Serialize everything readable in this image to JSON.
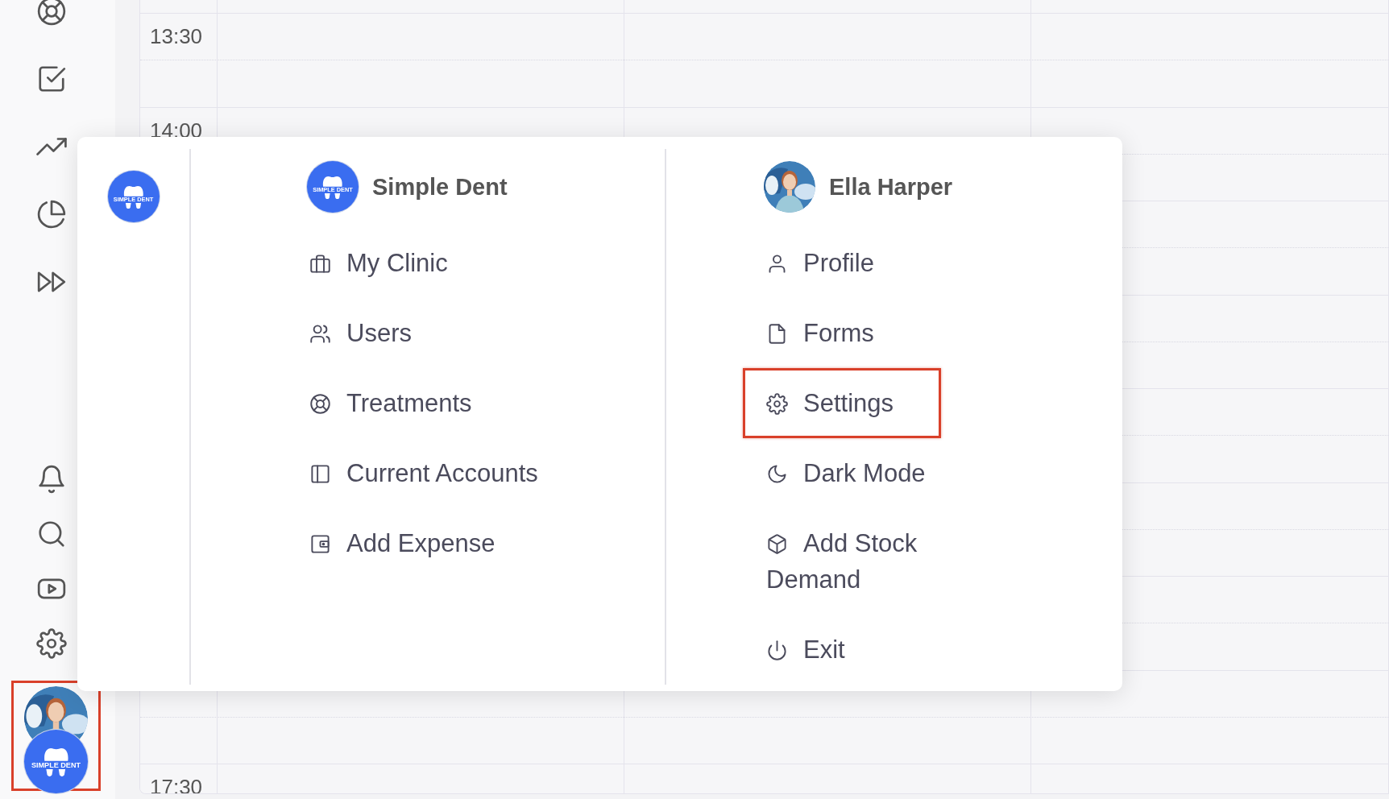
{
  "sidebar": {
    "account_switcher": {
      "highlighted": true,
      "logo_text": "SIMPLE DENT"
    }
  },
  "calendar": {
    "upper_times": [
      "13:30",
      "14:00"
    ],
    "lower_times": [
      "17:30"
    ]
  },
  "menu": {
    "logo_text": "SIMPLE DENT",
    "clinic": {
      "logo_text": "SIMPLE DENT",
      "name": "Simple Dent",
      "items": [
        {
          "label": "My Clinic",
          "highlighted": false
        },
        {
          "label": "Users",
          "highlighted": false
        },
        {
          "label": "Treatments",
          "highlighted": false
        },
        {
          "label": "Current Accounts",
          "highlighted": false
        },
        {
          "label": "Add Expense",
          "highlighted": false
        }
      ]
    },
    "account": {
      "name": "Ella Harper",
      "items": [
        {
          "label": "Profile",
          "highlighted": false
        },
        {
          "label": "Forms",
          "highlighted": false
        },
        {
          "label": "Settings",
          "highlighted": true
        },
        {
          "label": "Dark Mode",
          "highlighted": false
        },
        {
          "label": "Add Stock Demand",
          "highlighted": false
        },
        {
          "label": "Exit",
          "highlighted": false
        }
      ]
    }
  }
}
